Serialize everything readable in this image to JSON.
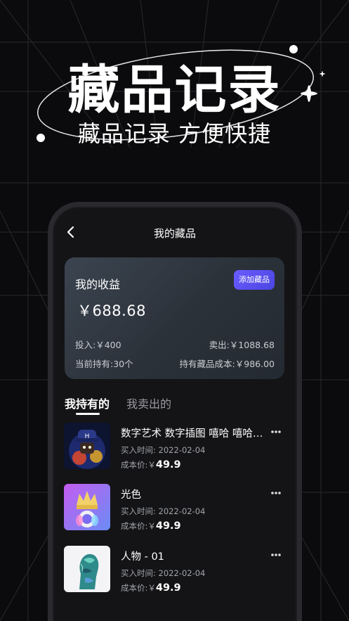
{
  "hero": {
    "title": "藏品记录",
    "subtitle": "藏品记录 方便快捷"
  },
  "nav": {
    "title": "我的藏品",
    "back_icon": "chevron-left-icon"
  },
  "earnings": {
    "title": "我的收益",
    "add_button": "添加藏品",
    "amount": "￥688.68",
    "invest": "投入:￥400",
    "sold": "卖出:￥1088.68",
    "holding": "当前持有:30个",
    "cost": "持有藏品成本:￥986.00"
  },
  "tabs": [
    {
      "label": "我持有的",
      "active": true
    },
    {
      "label": "我卖出的",
      "active": false
    }
  ],
  "items": [
    {
      "name": "数字艺术 数字插图 嘻哈 嘻哈图片",
      "date": "买入时间:  2022-02-04",
      "price_label": "成本价:￥",
      "price": "49.9"
    },
    {
      "name": "光色",
      "date": "买入时间:  2022-02-04",
      "price_label": "成本价:￥",
      "price": "49.9"
    },
    {
      "name": "人物 - 01",
      "date": "买入时间:  2022-02-04",
      "price_label": "成本价:￥",
      "price": "49.9"
    }
  ],
  "colors": {
    "background": "#0b0b0d",
    "accent": "#5b50f0",
    "card": "#2f363f"
  }
}
